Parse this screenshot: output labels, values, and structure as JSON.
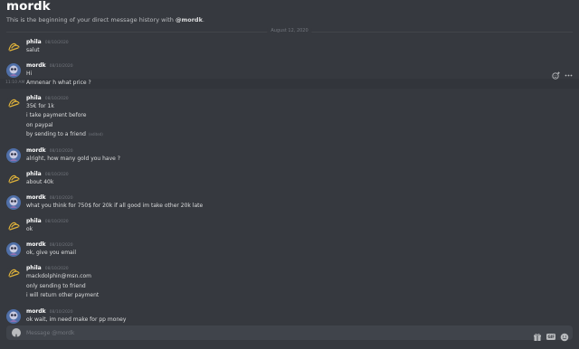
{
  "header": {
    "title": "mordk",
    "intro_prefix": "This is the beginning of your direct message history with ",
    "intro_mention": "@mordk",
    "intro_suffix": "."
  },
  "divider": {
    "label": "August 12, 2020"
  },
  "messages": [
    {
      "author": "phila",
      "time": "08/10/2020",
      "avatar": "phila-avatar",
      "lines": [
        "salut"
      ]
    },
    {
      "author": "mordk",
      "time": "08/10/2020",
      "avatar": "mordk-avatar",
      "lines": [
        "Hi"
      ]
    },
    {
      "hover_time": "11:10 AM",
      "text": "Amnenar h what price ?"
    },
    {
      "author": "phila",
      "time": "08/10/2020",
      "avatar": "phila-avatar",
      "lines": [
        "35€ for 1k",
        "i take payment before",
        "on paypal",
        "by sending to a friend"
      ],
      "edited": "(edited)"
    },
    {
      "author": "mordk",
      "time": "08/10/2020",
      "avatar": "mordk-avatar",
      "lines": [
        "alright, how many gold you have ?"
      ]
    },
    {
      "author": "phila",
      "time": "08/10/2020",
      "avatar": "phila-avatar",
      "lines": [
        "about 40k"
      ]
    },
    {
      "author": "mordk",
      "time": "08/10/2020",
      "avatar": "mordk-avatar",
      "lines": [
        "what you think for 750$ for 20k if all good im take other 20k late"
      ]
    },
    {
      "author": "phila",
      "time": "08/10/2020",
      "avatar": "phila-avatar",
      "lines": [
        "ok"
      ]
    },
    {
      "author": "mordk",
      "time": "08/10/2020",
      "avatar": "mordk-avatar",
      "lines": [
        "ok, give you email"
      ]
    },
    {
      "author": "phila",
      "time": "08/10/2020",
      "avatar": "phila-avatar",
      "lines": [
        "mackdolphin@msn.com",
        "only sending to friend",
        "i will return other payment"
      ]
    },
    {
      "author": "mordk",
      "time": "08/10/2020",
      "avatar": "mordk-avatar",
      "lines": [
        "ok wait, im need make for pp money"
      ]
    }
  ],
  "hover_toolbar": {
    "icons": [
      "add-reaction-icon",
      "more-options-icon"
    ]
  },
  "composer": {
    "placeholder": "Message @mordk",
    "gif_label": "GIF",
    "icons": [
      "add-attachment-icon",
      "gift-icon",
      "gif-icon",
      "emoji-icon"
    ]
  },
  "colors": {
    "background": "#36393f",
    "composer": "#40444b",
    "username": "#ffffff",
    "text": "#dcddde",
    "muted": "#72767d",
    "avatar_mordk_bg": "#4f6fa8",
    "avatar_phila_glyph": "#e0b33a"
  }
}
